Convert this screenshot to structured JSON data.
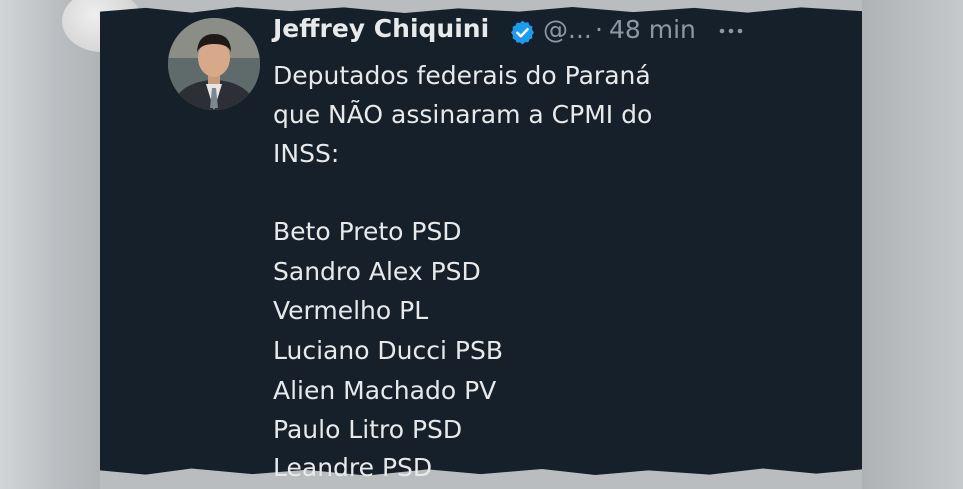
{
  "tweet": {
    "author_name": "Jeffrey Chiquini",
    "handle": "@...",
    "separator": "·",
    "time": "48 min",
    "verified_icon": "verified-badge-icon",
    "more_icon": "more-options-icon",
    "lines": [
      "Deputados federais do Paraná",
      "que NÃO assinaram a CPMI do",
      "INSS:",
      "",
      "Beto Preto PSD",
      "Sandro Alex PSD",
      "Vermelho PL",
      "Luciano Ducci PSB",
      "Alien Machado PV",
      "Paulo Litro PSD",
      "Leandre PSD"
    ]
  },
  "colors": {
    "card_background": "#16202b",
    "text_primary": "#e7e9ea",
    "text_secondary": "#8b98a5",
    "verified_blue": "#1d9bf0",
    "page_background": "#b9bdc0"
  }
}
